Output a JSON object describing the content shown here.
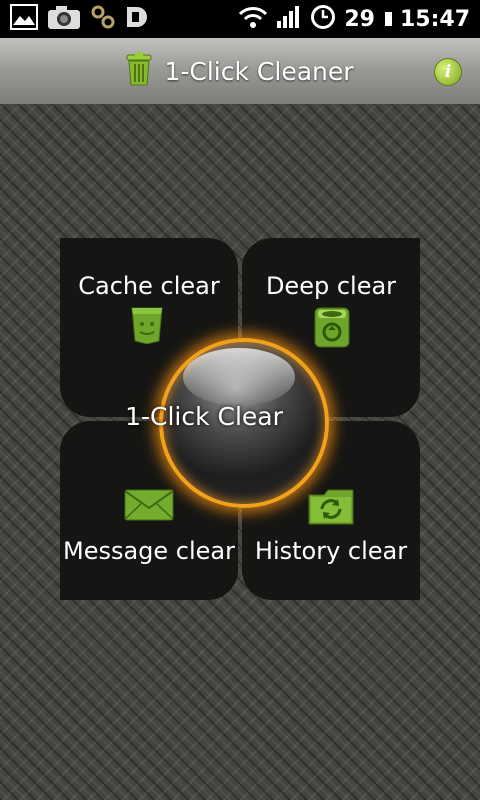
{
  "status_bar": {
    "icons": [
      "gallery-icon",
      "camera-icon",
      "usb-link-icon",
      "usb-debug-icon",
      "wifi-icon",
      "signal-icon",
      "clock-icon"
    ],
    "battery_level": "29",
    "time": "15:47"
  },
  "app": {
    "title": "1-Click Cleaner",
    "info_icon": "info-icon"
  },
  "cleaner": {
    "center_label": "1-Click Clear",
    "cache": {
      "label": "Cache clear",
      "icon": "bin-icon"
    },
    "deep": {
      "label": "Deep clear",
      "icon": "trash-can-icon"
    },
    "message": {
      "label": "Message clear",
      "icon": "envelope-icon"
    },
    "history": {
      "label": "History clear",
      "icon": "refresh-folder-icon"
    }
  },
  "colors": {
    "accent_green": "#7fb52c",
    "orb_ring": "#f2a11a",
    "tile_background": "#151513"
  }
}
